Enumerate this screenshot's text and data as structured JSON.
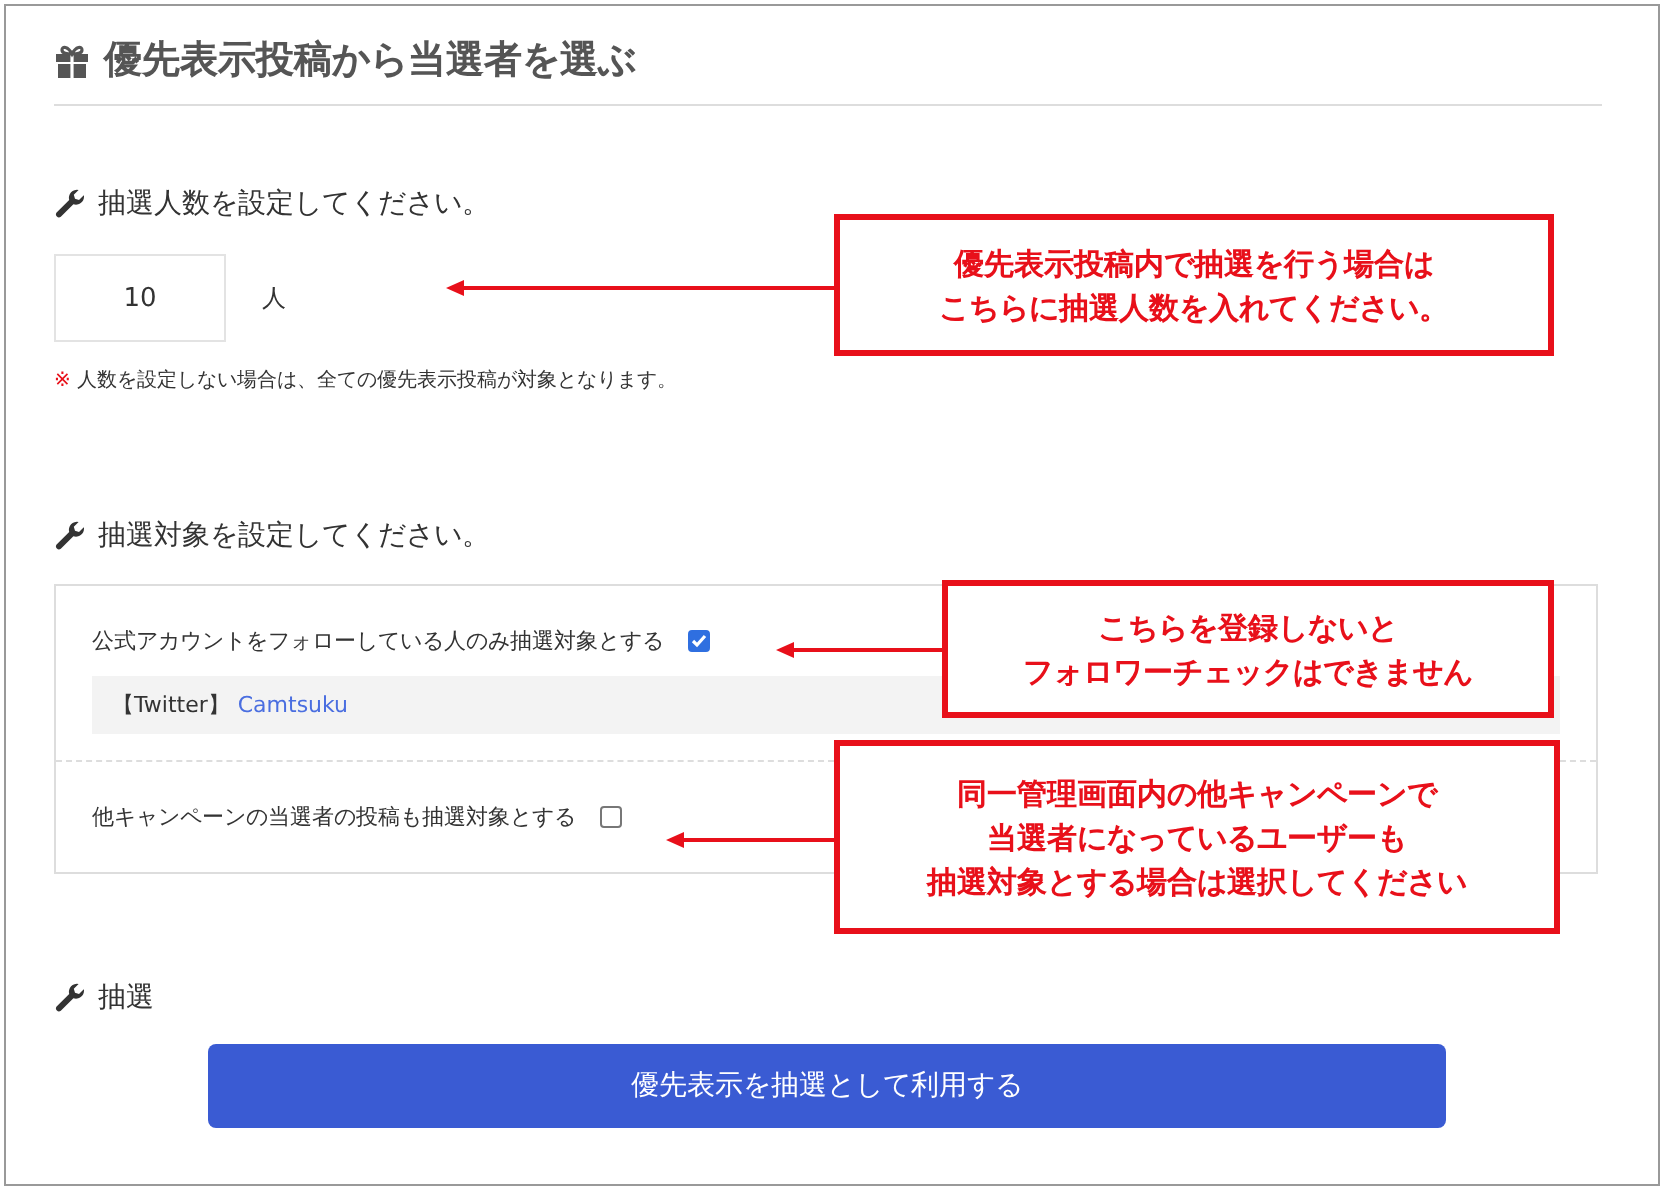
{
  "title": "優先表示投稿から当選者を選ぶ",
  "count_section": {
    "heading": "抽選人数を設定してください。",
    "value": "10",
    "unit": "人",
    "note_mark": "※",
    "note": "人数を設定しない場合は、全ての優先表示投稿が対象となります。"
  },
  "target_section": {
    "heading": "抽選対象を設定してください。",
    "options": [
      {
        "label": "公式アカウントをフォローしている人のみ抽選対象とする",
        "checked": true,
        "account_prefix": "【Twitter】",
        "account": "Camtsuku"
      },
      {
        "label": "他キャンペーンの当選者の投稿も抽選対象とする",
        "checked": false
      }
    ]
  },
  "draw_section": {
    "heading": "抽選",
    "button": "優先表示を抽選として利用する"
  },
  "callouts": [
    {
      "lines": [
        "優先表示投稿内で抽選を行う場合は",
        "こちらに抽選人数を入れてください。"
      ]
    },
    {
      "lines": [
        "こちらを登録しないと",
        "フォロワーチェックはできません"
      ]
    },
    {
      "lines": [
        "同一管理画面内の他キャンペーンで",
        "当選者になっているユーザーも",
        "抽選対象とする場合は選択してください"
      ]
    }
  ]
}
